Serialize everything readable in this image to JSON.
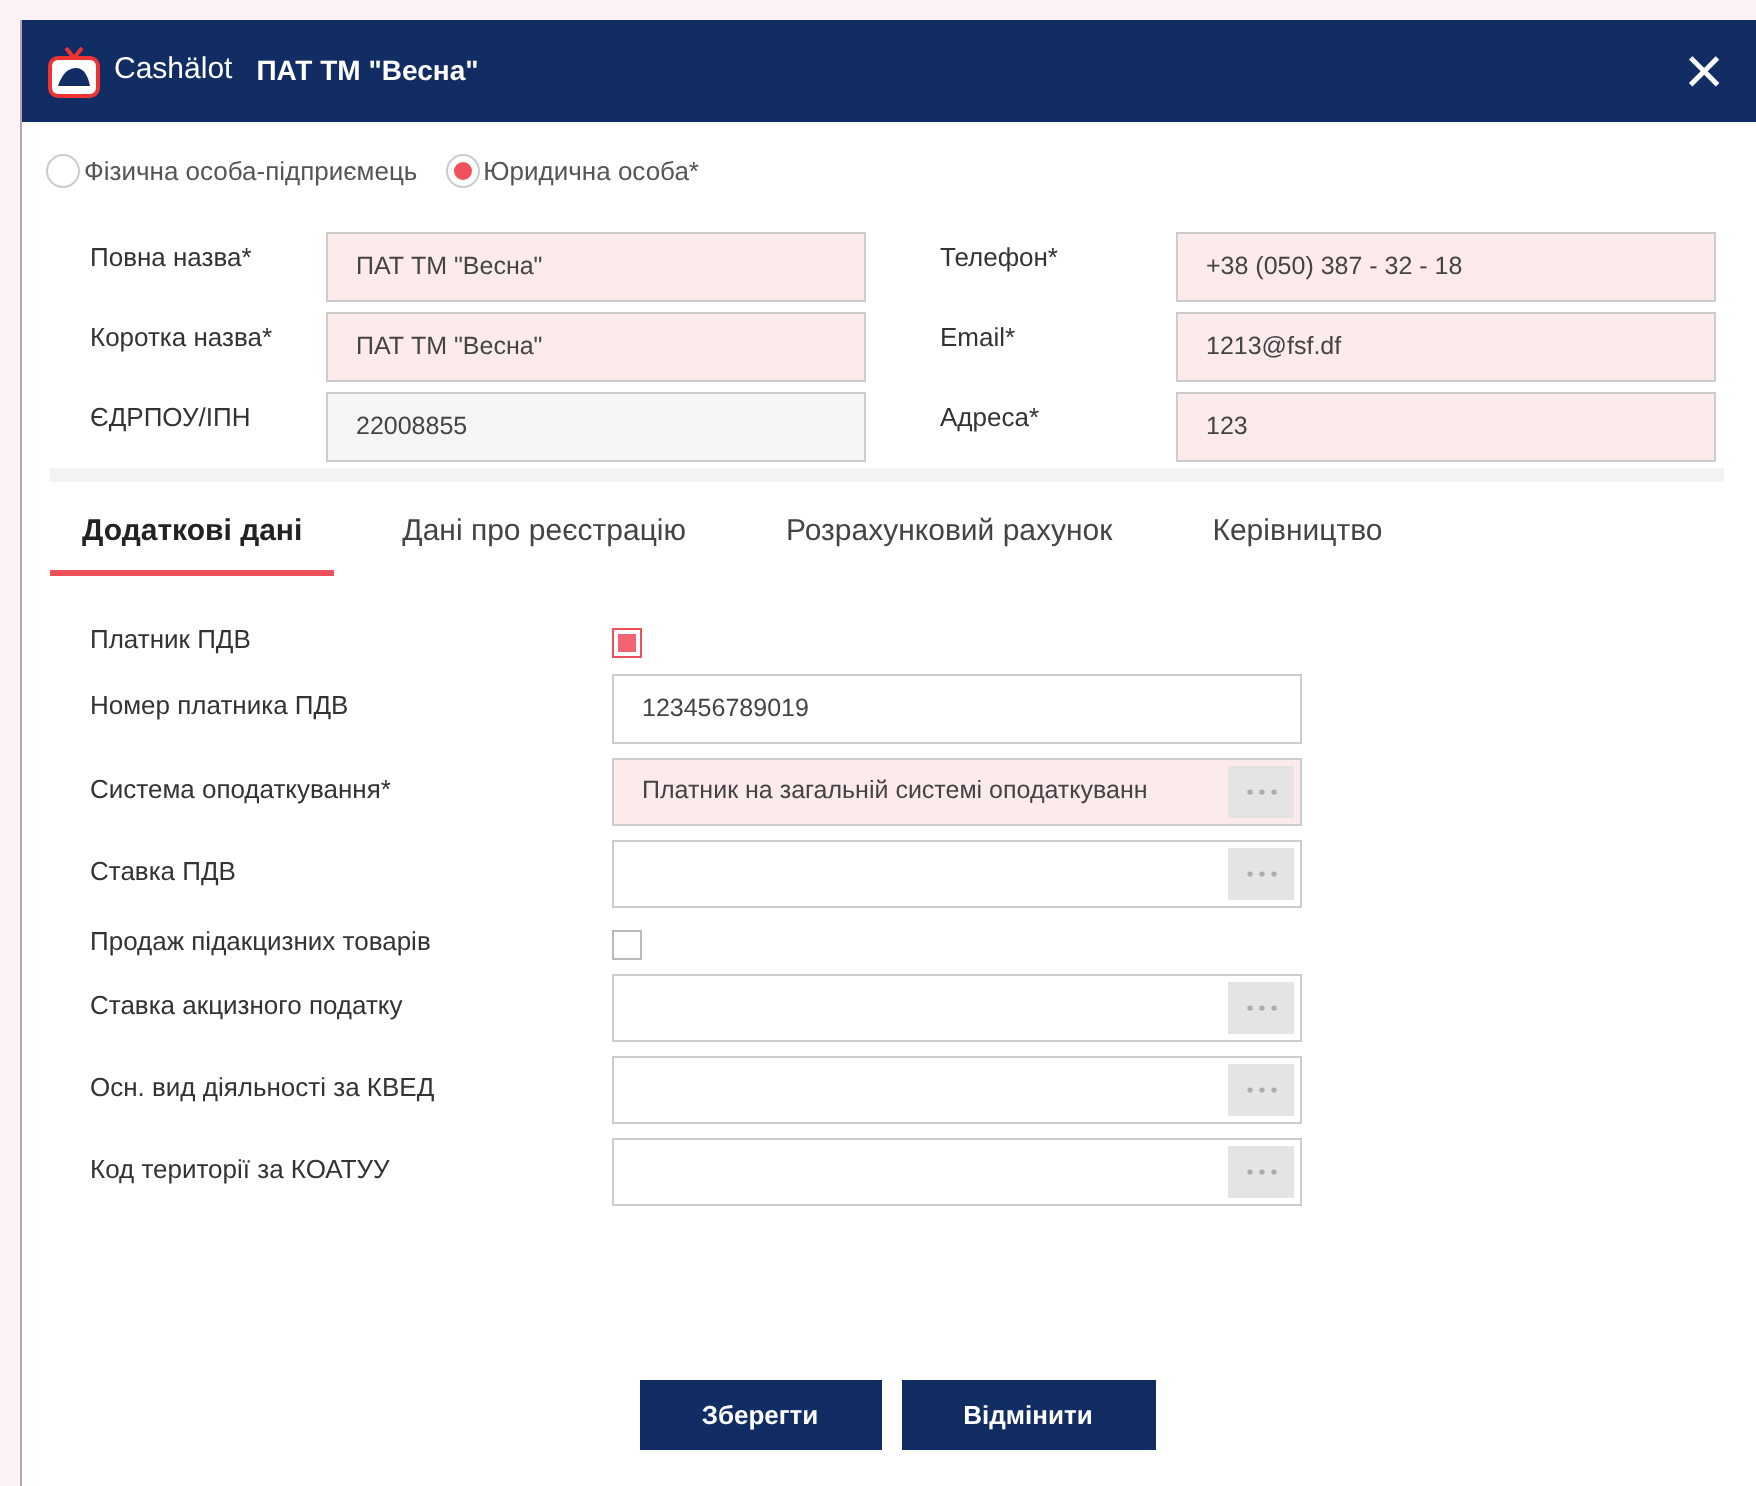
{
  "window": {
    "logo": "Cashälot",
    "title": "ПАТ ТМ \"Весна\"",
    "close": "×"
  },
  "person_type": [
    {
      "label": "Фізична особа-підприємець",
      "selected": false
    },
    {
      "label": "Юридична особа*",
      "selected": true
    }
  ],
  "main_fields": [
    {
      "kind": "required",
      "label": "Повна назва*",
      "value": "ПАТ ТМ \"Весна\""
    },
    {
      "kind": "required",
      "label": "Телефон*",
      "value": "+38 (050) 387 - 32 - 18"
    },
    {
      "kind": "required",
      "label": "Коротка назва*",
      "value": "ПАТ ТМ \"Весна\""
    },
    {
      "kind": "required",
      "label": "Email*",
      "value": "1213@fsf.df"
    },
    {
      "kind": "readonly",
      "label": "ЄДРПОУ/ІПН",
      "value": "22008855"
    },
    {
      "kind": "required",
      "label": "Адреса*",
      "value": "123"
    }
  ],
  "tabs": [
    {
      "label": "Додаткові дані",
      "selected": true
    },
    {
      "label": "Дані про реєстрацію",
      "selected": false
    },
    {
      "label": "Розрахунковий рахунок",
      "selected": false
    },
    {
      "label": "Керівництво",
      "selected": false
    }
  ],
  "details": [
    {
      "kind": "checkbox",
      "label": "Платник ПДВ",
      "checked": true
    },
    {
      "kind": "text",
      "label": "Номер платника ПДВ",
      "value": "123456789019",
      "required": false
    },
    {
      "kind": "picker",
      "label": "Система оподаткування*",
      "value": "Платник на загальній системі оподаткуванн",
      "required": true
    },
    {
      "kind": "picker",
      "label": "Ставка ПДВ",
      "required": false
    },
    {
      "kind": "checkbox",
      "label": "Продаж підакцизних товарів",
      "checked": false
    },
    {
      "kind": "picker",
      "label": "Ставка акцизного податку",
      "required": false
    },
    {
      "kind": "picker",
      "label": "Осн. вид діяльності за КВЕД",
      "required": false
    },
    {
      "kind": "picker",
      "label": "Код території за КОАТУУ",
      "required": false
    }
  ],
  "buttons": [
    "Зберегти",
    "Відмінити"
  ]
}
